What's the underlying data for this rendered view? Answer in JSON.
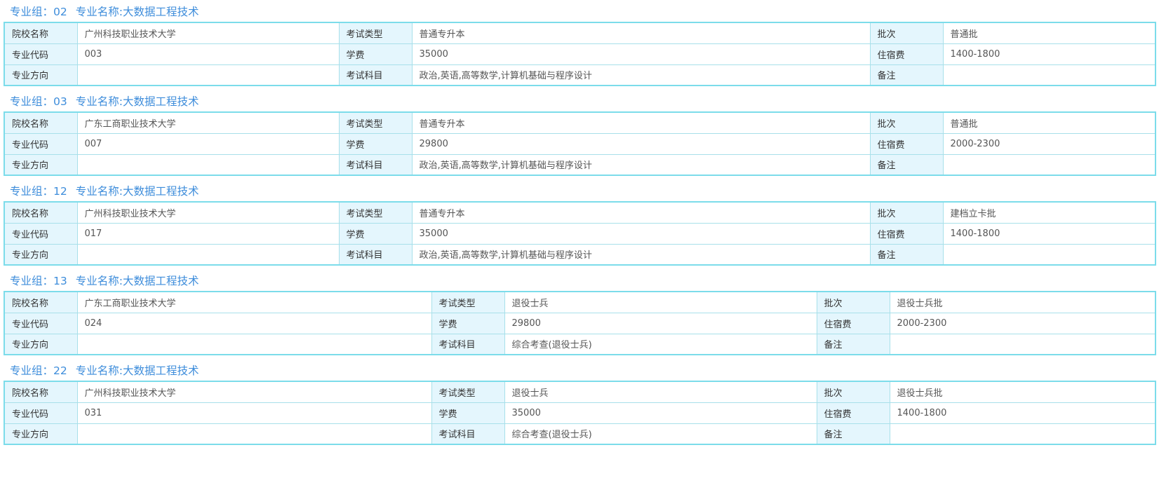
{
  "labels": {
    "school": "院校名称",
    "exam_type": "考试类型",
    "batch": "批次",
    "major_code": "专业代码",
    "tuition": "学费",
    "dorm_fee": "住宿费",
    "direction": "专业方向",
    "subjects": "考试科目",
    "remark": "备注"
  },
  "groups": [
    {
      "title_prefix": "专业组：02",
      "title_major": "专业名称:大数据工程技术",
      "school": "广州科技职业技术大学",
      "exam_type": "普通专升本",
      "batch": "普通批",
      "major_code": "003",
      "tuition": "35000",
      "dorm_fee": "1400-1800",
      "direction": "",
      "subjects": "政治,英语,高等数学,计算机基础与程序设计",
      "remark": ""
    },
    {
      "title_prefix": "专业组：03",
      "title_major": "专业名称:大数据工程技术",
      "school": "广东工商职业技术大学",
      "exam_type": "普通专升本",
      "batch": "普通批",
      "major_code": "007",
      "tuition": "29800",
      "dorm_fee": "2000-2300",
      "direction": "",
      "subjects": "政治,英语,高等数学,计算机基础与程序设计",
      "remark": ""
    },
    {
      "title_prefix": "专业组：12",
      "title_major": "专业名称:大数据工程技术",
      "school": "广州科技职业技术大学",
      "exam_type": "普通专升本",
      "batch": "建档立卡批",
      "major_code": "017",
      "tuition": "35000",
      "dorm_fee": "1400-1800",
      "direction": "",
      "subjects": "政治,英语,高等数学,计算机基础与程序设计",
      "remark": ""
    },
    {
      "title_prefix": "专业组：13",
      "title_major": "专业名称:大数据工程技术",
      "school": "广东工商职业技术大学",
      "exam_type": "退役士兵",
      "batch": "退役士兵批",
      "major_code": "024",
      "tuition": "29800",
      "dorm_fee": "2000-2300",
      "direction": "",
      "subjects": "综合考查(退役士兵)",
      "remark": ""
    },
    {
      "title_prefix": "专业组：22",
      "title_major": "专业名称:大数据工程技术",
      "school": "广州科技职业技术大学",
      "exam_type": "退役士兵",
      "batch": "退役士兵批",
      "major_code": "031",
      "tuition": "35000",
      "dorm_fee": "1400-1800",
      "direction": "",
      "subjects": "综合考查(退役士兵)",
      "remark": ""
    }
  ]
}
